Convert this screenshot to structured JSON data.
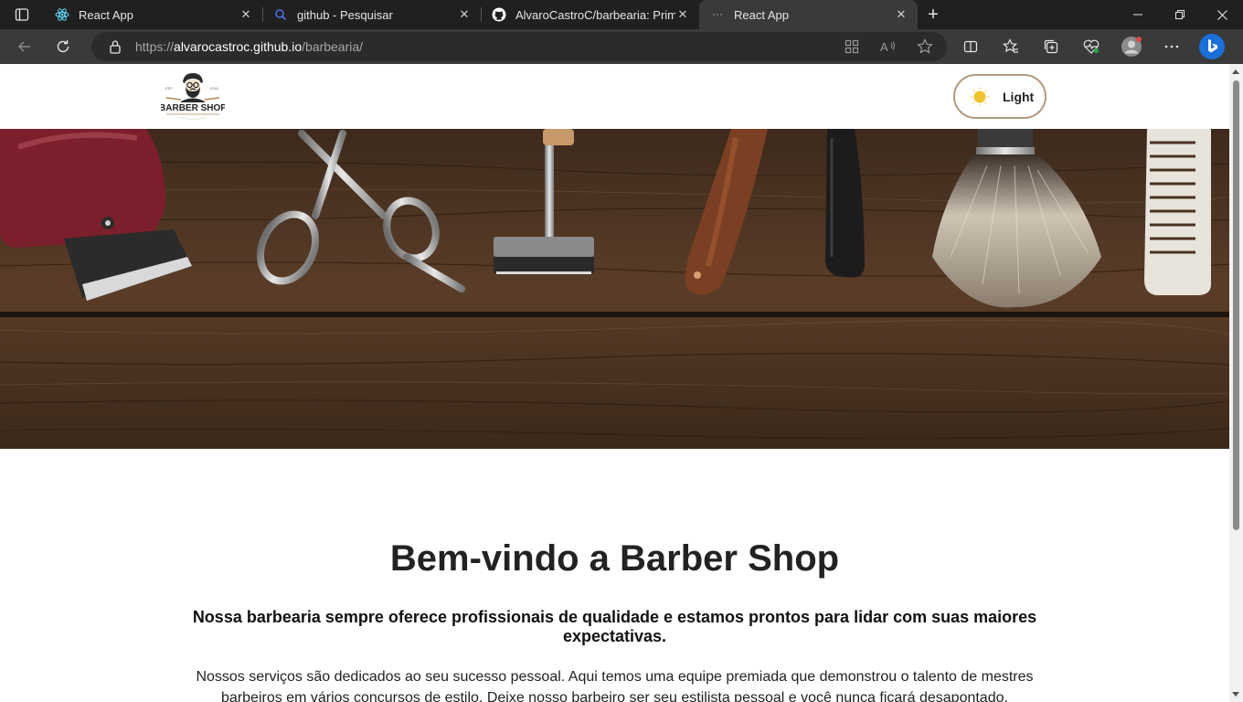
{
  "browser": {
    "tabs": [
      {
        "title": "React App",
        "icon": "react-icon",
        "active": false
      },
      {
        "title": "github - Pesquisar",
        "icon": "search-icon",
        "active": false
      },
      {
        "title": "AlvaroCastroC/barbearia: Primeir",
        "icon": "github-icon",
        "active": false
      },
      {
        "title": "React App",
        "icon": "loading-icon",
        "active": true
      }
    ],
    "close_glyph": "✕",
    "new_tab_glyph": "+",
    "address": {
      "scheme": "https://",
      "host": "alvarocastroc.github.io",
      "path": "/barbearia/"
    }
  },
  "site": {
    "logo": {
      "line1": "BARBER SHOP",
      "years_left": "EST",
      "years_right": "2016"
    },
    "theme_toggle": {
      "label": "Light",
      "icon": "sun-icon",
      "accent": "#b09a80",
      "sun_color": "#f2c230"
    },
    "hero": {
      "tools": [
        "clipper",
        "scissors",
        "safety-razor",
        "straight-razor",
        "comb-handle",
        "shaving-brush",
        "comb"
      ]
    },
    "welcome": {
      "title": "Bem-vindo a Barber Shop",
      "subtitle": "Nossa barbearia sempre oferece profissionais de qualidade e estamos prontos para lidar com suas maiores expectativas.",
      "paragraph": "Nossos serviços são dedicados ao seu sucesso pessoal. Aqui temos uma equipe premiada que demonstrou o talento de mestres barbeiros em vários concursos de estilo. Deixe nosso barbeiro ser seu estilista pessoal e você nunca ficará desapontado."
    }
  },
  "colors": {
    "chrome_dark": "#202020",
    "chrome_bar": "#3a3a3a",
    "wood": "#4a3221"
  }
}
